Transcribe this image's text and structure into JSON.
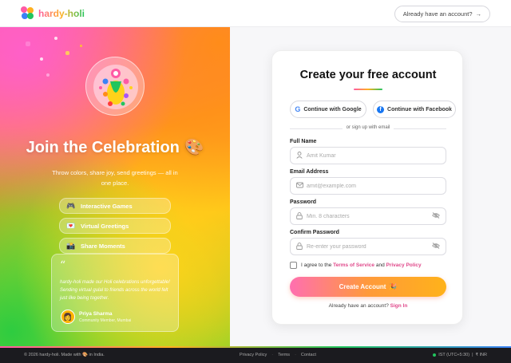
{
  "header": {
    "brand": "hardy-holi",
    "have_account": "Already have an account?",
    "arrow": "→"
  },
  "hero": {
    "title": "Join the Celebration",
    "title_emoji": "🎨",
    "subtitle": "Throw colors, share joy, send greetings — all in one place.",
    "features": [
      {
        "icon": "🎮",
        "label": "Interactive Games"
      },
      {
        "icon": "💌",
        "label": "Virtual Greetings"
      },
      {
        "icon": "📸",
        "label": "Share Moments"
      }
    ],
    "testimonial": {
      "quote_mark": "“",
      "text": "hardy-holi made our Holi celebrations unforgettable! Sending virtual gulal to friends across the world felt just like being together.",
      "avatar": "👩",
      "name": "Priya Sharma",
      "role": "Community Member, Mumbai"
    }
  },
  "form": {
    "title": "Create your free account",
    "google_label": "Continue with Google",
    "facebook_label": "Continue with Facebook",
    "divider": "or sign up with email",
    "full_name_label": "Full Name",
    "full_name_placeholder": "Amit Kumar",
    "email_label": "Email Address",
    "email_placeholder": "amit@example.com",
    "password_label": "Password",
    "password_placeholder": "Min. 8 characters",
    "confirm_label": "Confirm Password",
    "confirm_placeholder": "Re-enter your password",
    "agree_prefix": "I agree to the",
    "terms": "Terms of Service",
    "and": "and",
    "privacy": "Privacy Policy",
    "create_label": "Create Account",
    "create_emoji": "🎉",
    "signin_prefix": "Already have an account?",
    "signin_link": "Sign In"
  },
  "footer": {
    "copyright": "© 2026 hardy-holi. Made with",
    "copyright_emoji": "🎨",
    "copyright_suffix": "in India.",
    "links": [
      "Privacy Policy",
      "Terms",
      "Contact"
    ],
    "timezone": "IST (UTC+5:30)",
    "currency": "₹ INR"
  },
  "colors": {
    "accent_pink": "#e0488a",
    "accent_orange": "#ff9a3a",
    "accent_yellow": "#ffb21a",
    "accent_green": "#22c55e"
  },
  "icons": {
    "user": "user-icon",
    "email": "mail-icon",
    "lock": "lock-icon",
    "eye_off": "eye-off-icon"
  }
}
